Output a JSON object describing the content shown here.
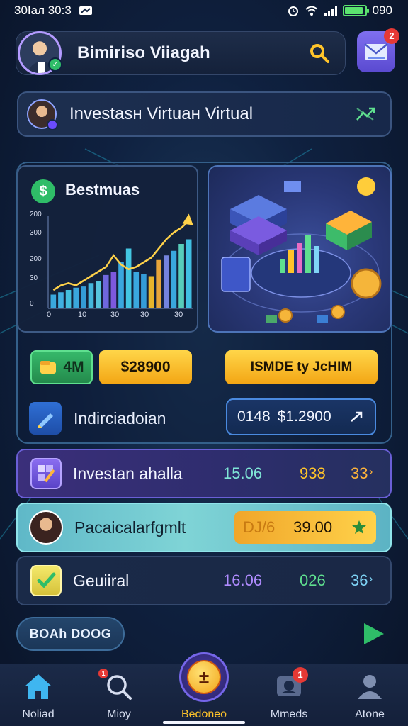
{
  "status_bar": {
    "time": "30Іал 30:3",
    "battery_label": "090",
    "battery_level": 0.9
  },
  "header": {
    "title": "Bimirisо Viiagah",
    "mail_badge": "2"
  },
  "profile_card": {
    "label": "Investasн Virtuaн Virtual"
  },
  "chart_card": {
    "title": "Bestmuas",
    "chart_data": {
      "type": "bar",
      "x": [
        1,
        2,
        3,
        4,
        5,
        6,
        7,
        8,
        9,
        10,
        11,
        12,
        13,
        14,
        15,
        16,
        17,
        18,
        19
      ],
      "values": [
        60,
        70,
        80,
        90,
        95,
        110,
        120,
        145,
        160,
        200,
        260,
        160,
        150,
        140,
        210,
        230,
        250,
        280,
        300
      ],
      "trend": [
        80,
        100,
        110,
        100,
        120,
        140,
        160,
        180,
        230,
        190,
        170,
        180,
        200,
        220,
        260,
        300,
        330,
        350,
        380
      ],
      "y_ticks": [
        "200",
        "300",
        "200",
        "30",
        "0"
      ],
      "x_ticks": [
        "0",
        "10",
        "30",
        "30",
        "30"
      ]
    }
  },
  "pills": {
    "green_label": "4M",
    "gold_value": "$28900",
    "gold_wide_label": "ISMDE ty JcHIM"
  },
  "investment": {
    "label": "Indirciadoian",
    "value_code": "0148",
    "value_amount": "$1.2900"
  },
  "rows": [
    {
      "label": "Investan ahalla",
      "c1": "15.06",
      "c2": "938",
      "c3": "33"
    },
    {
      "label": "Pacaicalarfgmlt",
      "c1": "DJ/6",
      "c2": "39.00"
    },
    {
      "label": "Geuiiral",
      "c1": "16.06",
      "c2": "026",
      "c3": "36"
    }
  ],
  "cta": {
    "label": "BOAh DOOG"
  },
  "nav": {
    "items": [
      {
        "label": "Noliad"
      },
      {
        "label": "Mioy"
      },
      {
        "label": "Bedoneo"
      },
      {
        "label": "Mmeds"
      },
      {
        "label": "Atone"
      }
    ],
    "badge_search": "1",
    "badge_messages": "1"
  },
  "colors": {
    "accent_gold": "#ffd24a",
    "accent_purple": "#6a5fd6",
    "accent_green": "#2fbd68",
    "accent_cyan": "#7fd4d6"
  }
}
